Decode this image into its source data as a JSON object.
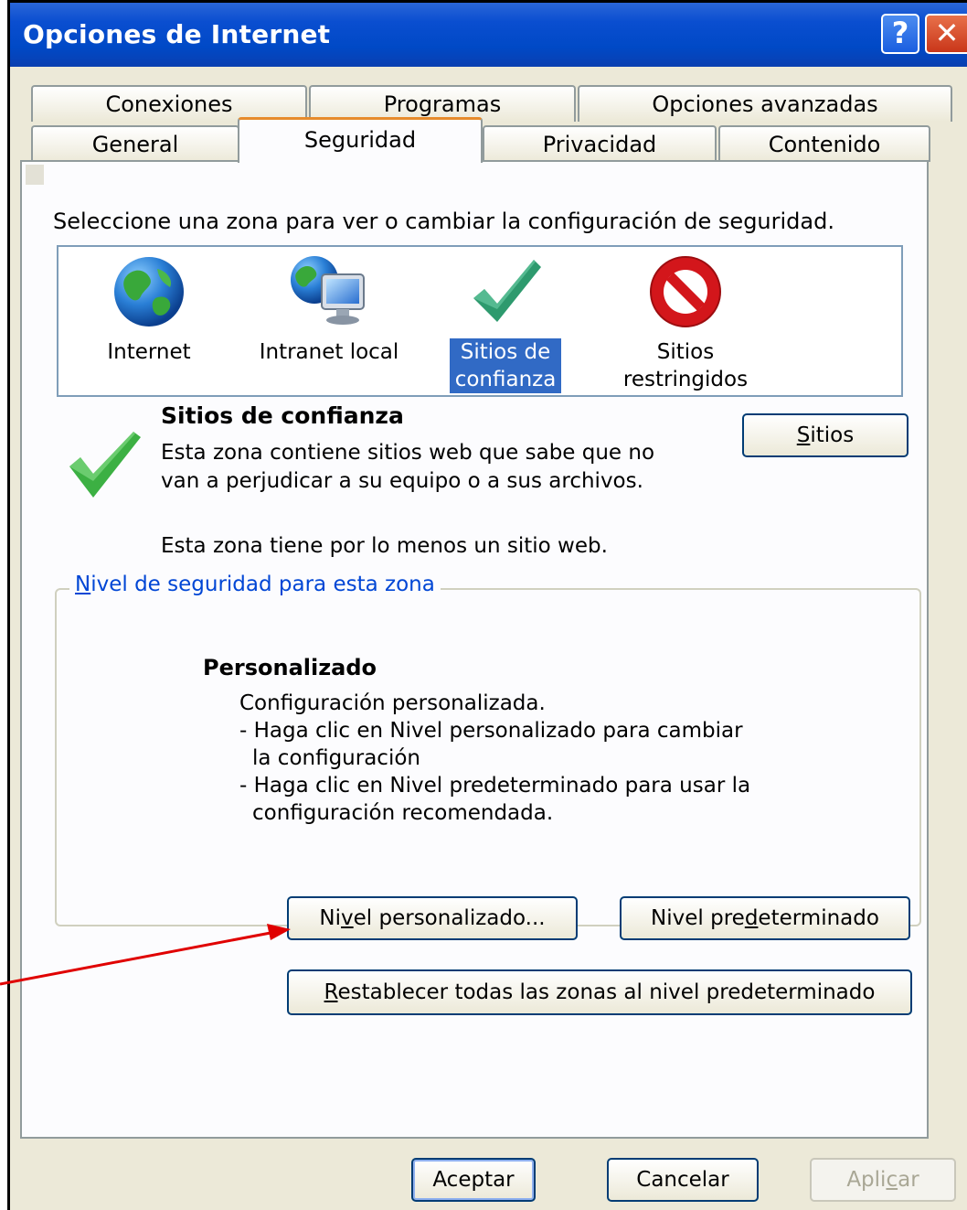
{
  "window": {
    "title": "Opciones de Internet",
    "help_glyph": "?",
    "close_glyph": "✕"
  },
  "tabs": {
    "row1": [
      "Conexiones",
      "Programas",
      "Opciones avanzadas"
    ],
    "row2": [
      "General",
      "Seguridad",
      "Privacidad",
      "Contenido"
    ],
    "active": "Seguridad"
  },
  "security": {
    "instruction": "Seleccione una zona para ver o cambiar la configuración de seguridad.",
    "zones": [
      {
        "line1": "Internet",
        "line2": "",
        "icon": "globe-icon"
      },
      {
        "line1": "Intranet local",
        "line2": "",
        "icon": "intranet-globe-monitor-icon"
      },
      {
        "line1": "Sitios de",
        "line2": "confianza",
        "icon": "trusted-checkmark-icon",
        "selected": true
      },
      {
        "line1": "Sitios",
        "line2": "restringidos",
        "icon": "restricted-stop-icon"
      }
    ],
    "selected_zone": {
      "title": "Sitios de confianza",
      "desc_line1": "Esta zona contiene sitios web que sabe que no",
      "desc_line2": "van a perjudicar a su equipo o a sus archivos.",
      "count_text": "Esta zona tiene por lo menos un sitio web.",
      "sites_button": {
        "pre": "",
        "accel": "S",
        "post": "itios"
      }
    },
    "level_group": {
      "legend": {
        "pre": "",
        "accel": "N",
        "post": "ivel de seguridad para esta zona"
      },
      "level_title": "Personalizado",
      "lines": [
        "Configuración personalizada.",
        "- Haga clic en Nivel personalizado para cambiar",
        "la configuración",
        "- Haga clic en Nivel predeterminado para usar la",
        "configuración recomendada."
      ],
      "custom_button": {
        "pre": "Ni",
        "accel": "v",
        "post": "el personalizado..."
      },
      "default_button": {
        "pre": "Nivel pre",
        "accel": "d",
        "post": "eterminado"
      }
    },
    "reset_button": {
      "pre": "",
      "accel": "R",
      "post": "establecer todas las zonas al nivel predeterminado"
    }
  },
  "footer": {
    "ok": "Aceptar",
    "cancel": "Cancelar",
    "apply": {
      "pre": "Apli",
      "accel": "c",
      "post": "ar"
    }
  },
  "colors": {
    "title_bar": "#0a4ed0",
    "active_tab_accent": "#e68b2c",
    "selection": "#316ac5",
    "annotation_arrow": "#e00000"
  }
}
